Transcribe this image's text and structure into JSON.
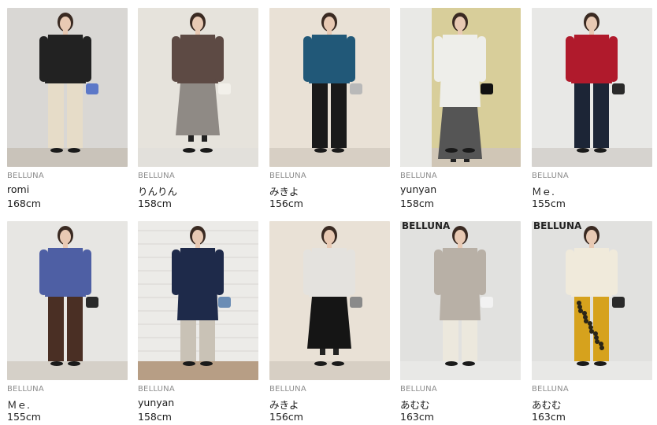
{
  "items": [
    {
      "brand": "BELLUNA",
      "name": "romi",
      "height": "168cm",
      "photo_description": "woman in black knit top and cream wide pants holding white bag",
      "colors": {
        "bg": "#d9d7d4",
        "floor": "#c9c3ba",
        "top": "#222222",
        "bottom": "#e6dcc8",
        "accent": "#5c78c8"
      }
    },
    {
      "brand": "BELLUNA",
      "name": "りんりん",
      "height": "158cm",
      "photo_description": "woman in brown pullover and pleated patterned skirt",
      "colors": {
        "bg": "#e6e3dc",
        "floor": "#e2e0db",
        "top": "#5d4a44",
        "bottom": "#8f8a85",
        "accent": "#f2f0ea"
      }
    },
    {
      "brand": "BELLUNA",
      "name": "みきよ",
      "height": "156cm",
      "photo_description": "woman in teal sweater and black pants with patterned bag",
      "colors": {
        "bg": "#e9e1d6",
        "floor": "#d7cfc4",
        "top": "#215878",
        "bottom": "#1a1a1a",
        "accent": "#b9b9b9"
      }
    },
    {
      "brand": "BELLUNA",
      "name": "yunyan",
      "height": "158cm",
      "photo_description": "woman in white long cardigan, stripe top and grey skirt",
      "colors": {
        "bg": "#d8ce9a",
        "floor": "#d0c6b6",
        "top": "#eeeeea",
        "bottom": "#555555",
        "accent": "#111111"
      }
    },
    {
      "brand": "BELLUNA",
      "name": "Ｍｅ.",
      "height": "155cm",
      "photo_description": "woman in red sweater and navy wide pants",
      "colors": {
        "bg": "#e8e8e6",
        "floor": "#d6d3cf",
        "top": "#b01a2c",
        "bottom": "#1c2536",
        "accent": "#2a2a2a"
      }
    },
    {
      "brand": "BELLUNA",
      "name": "Ｍｅ.",
      "height": "155cm",
      "photo_description": "woman in blue knit top and brown wide pants",
      "colors": {
        "bg": "#e7e6e3",
        "floor": "#d5d0c8",
        "top": "#4e5fa4",
        "bottom": "#4a2f24",
        "accent": "#2a2a2a"
      }
    },
    {
      "brand": "BELLUNA",
      "name": "yunyan",
      "height": "158cm",
      "photo_description": "woman in navy long cardigan and beige pants by white brick wall",
      "colors": {
        "bg": "#ecebe8",
        "floor": "#b79e85",
        "top": "#1e2a4a",
        "bottom": "#c9c2b6",
        "accent": "#6b8db5"
      }
    },
    {
      "brand": "BELLUNA",
      "name": "みきよ",
      "height": "156cm",
      "photo_description": "woman in white sweater and black skirt with patterned bag",
      "colors": {
        "bg": "#e9e1d6",
        "floor": "#d7cfc4",
        "top": "#e4e2de",
        "bottom": "#151515",
        "accent": "#8a8a8a"
      }
    },
    {
      "brand": "BELLUNA",
      "name": "あむむ",
      "height": "163cm",
      "photo_description": "woman in grey jumper dress over white top and cream pants",
      "colors": {
        "bg": "#e1e1df",
        "floor": "#e8e8e6",
        "top": "#b8b0a6",
        "bottom": "#ece8dd",
        "accent": "#f2f2f2"
      }
    },
    {
      "brand": "BELLUNA",
      "name": "あむむ",
      "height": "163cm",
      "photo_description": "woman in cream vest over yellow floral dress",
      "colors": {
        "bg": "#e1e1df",
        "floor": "#e8e8e6",
        "top": "#f0eadb",
        "bottom": "#d6a21d",
        "accent": "#2a2a2a"
      }
    }
  ],
  "store_signage": "BELLUNA"
}
